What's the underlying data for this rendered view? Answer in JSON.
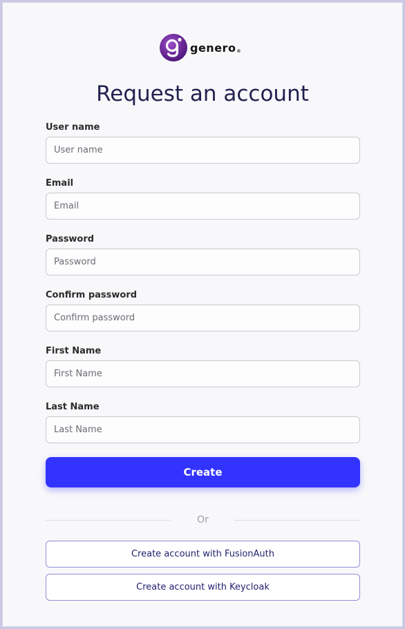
{
  "brand": {
    "name": "genero",
    "registered_mark": "®",
    "icon": "genero-logo-icon",
    "colors": {
      "mark_dark": "#5a1a8a",
      "mark_light": "#9a4ec8"
    }
  },
  "page": {
    "title": "Request an account"
  },
  "form": {
    "fields": [
      {
        "label": "User name",
        "placeholder": "User name",
        "value": ""
      },
      {
        "label": "Email",
        "placeholder": "Email",
        "value": ""
      },
      {
        "label": "Password",
        "placeholder": "Password",
        "value": ""
      },
      {
        "label": "Confirm password",
        "placeholder": "Confirm password",
        "value": ""
      },
      {
        "label": "First Name",
        "placeholder": "First Name",
        "value": ""
      },
      {
        "label": "Last Name",
        "placeholder": "Last Name",
        "value": ""
      }
    ],
    "submit_label": "Create"
  },
  "alternatives": {
    "divider_label": "Or",
    "fusionauth_label": "Create account with FusionAuth",
    "keycloak_label": "Create account with Keycloak"
  },
  "colors": {
    "accent": "#3333ff",
    "title_text": "#222250",
    "sso_border": "#8e8ed8"
  }
}
